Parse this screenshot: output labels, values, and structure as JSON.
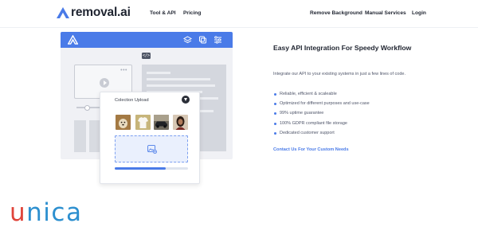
{
  "nav": {
    "logo_text": "removal.ai",
    "links": [
      "Tool & API",
      "Pricing"
    ],
    "right_links": [
      "Remove Background",
      "Manual Services",
      "Login"
    ]
  },
  "illustration": {
    "code_icon": "</>",
    "upload_card": {
      "title": "Colection Upload",
      "thumbnails": [
        {
          "name": "dog-photo",
          "color": "#b88a4e"
        },
        {
          "name": "tshirt-photo",
          "color": "#cdbb82"
        },
        {
          "name": "car-photo",
          "color": "#3a3f45"
        },
        {
          "name": "woman-photo",
          "color": "#8a5a3c"
        }
      ],
      "progress_fraction": 0.7
    }
  },
  "content": {
    "heading": "Easy API Integration For Speedy Workflow",
    "paragraph": "Integrate our API to your existing systems in just a few lines of code.",
    "features": [
      "Reliable, efficient & scaleable",
      "Optimized for different purposes and use-case",
      "99% uptime guarantee",
      "100% GDPR compliant file storage",
      "Dedicated customer support"
    ],
    "cta": "Contact Us For Your Custom Needs"
  },
  "watermark": {
    "part1": "u",
    "part2": "nica"
  },
  "colors": {
    "accent": "#4a7be8",
    "watermark_red": "#e0443a",
    "watermark_blue": "#2c8fcf"
  }
}
